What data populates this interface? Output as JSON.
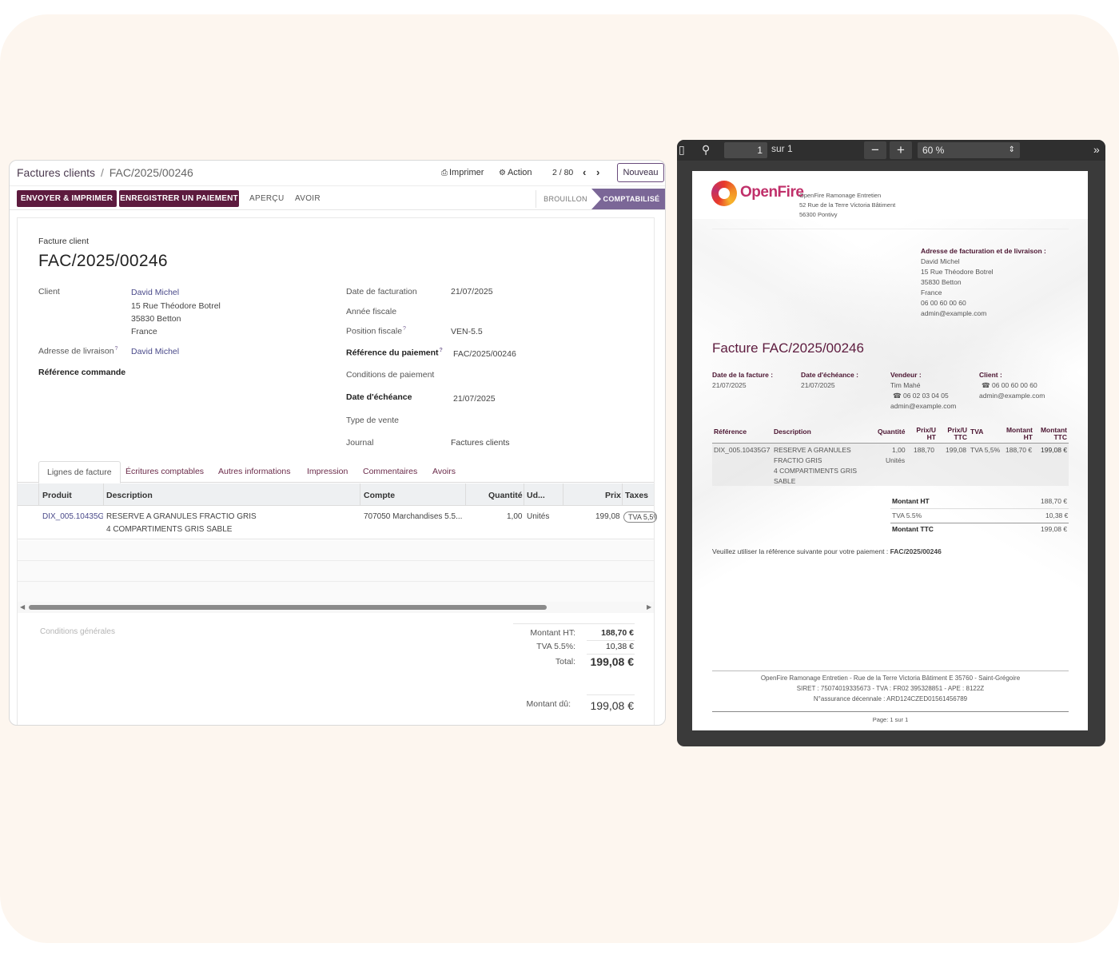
{
  "odoo": {
    "breadcrumb": {
      "parent": "Factures clients",
      "separator": "/",
      "current": "FAC/2025/00246"
    },
    "toolbar": {
      "print": "Imprimer",
      "action": "Action",
      "pager": "2 / 80",
      "new": "Nouveau"
    },
    "statusbar": {
      "send_print": "ENVOYER & IMPRIMER",
      "register_payment": "ENREGISTRER UN PAIEMENT",
      "preview": "APERÇU",
      "credit_note": "AVOIR",
      "stage_draft": "BROUILLON",
      "stage_posted": "COMPTABILISÉ"
    },
    "form": {
      "type_label": "Facture client",
      "number": "FAC/2025/00246",
      "client_label": "Client",
      "client_name": "David Michel",
      "client_street": "15 Rue Théodore Botrel",
      "client_city": "35830 Betton",
      "client_country": "France",
      "delivery_label": "Adresse de livraison",
      "delivery_value": "David Michel",
      "order_ref_label": "Référence commande",
      "invoice_date_label": "Date de facturation",
      "invoice_date": "21/07/2025",
      "fiscal_year_label": "Année fiscale",
      "fiscal_position_label": "Position fiscale",
      "fiscal_position": "VEN-5.5",
      "payment_ref_label": "Référence du paiement",
      "payment_ref": "FAC/2025/00246",
      "payment_terms_label": "Conditions de paiement",
      "due_date_label": "Date d'échéance",
      "due_date": "21/07/2025",
      "sale_type_label": "Type de vente",
      "journal_label": "Journal",
      "journal": "Factures clients",
      "help_mark": "?"
    },
    "tabs": [
      "Lignes de facture",
      "Écritures comptables",
      "Autres informations",
      "Impression",
      "Commentaires",
      "Avoirs"
    ],
    "lines": {
      "headers": {
        "product": "Produit",
        "description": "Description",
        "account": "Compte",
        "qty": "Quantité",
        "uom": "Ud...",
        "price": "Prix",
        "taxes": "Taxes"
      },
      "rows": [
        {
          "product": "DIX_005.10435G7",
          "desc1": "RESERVE A GRANULES FRACTIO GRIS",
          "desc2": "4 COMPARTIMENTS GRIS SABLE",
          "account": "707050 Marchandises 5.5...",
          "qty": "1,00",
          "uom": "Unités",
          "price": "199,08",
          "tax": "TVA 5,5%"
        }
      ]
    },
    "terms_placeholder": "Conditions générales",
    "totals": {
      "ht_label": "Montant HT:",
      "ht": "188,70 €",
      "tva_label": "TVA 5.5%:",
      "tva": "10,38 €",
      "total_label": "Total:",
      "total": "199,08 €",
      "due_label": "Montant dû:",
      "due": "199,08 €"
    }
  },
  "pdf": {
    "toolbar": {
      "page": "1",
      "of": "sur 1",
      "zoom_out": "−",
      "zoom_in": "+",
      "zoom": "60 %"
    },
    "company": {
      "logo_text": "OpenFire",
      "name": "OpenFire Ramonage Entretien",
      "street": "52 Rue de la Terre Victoria Bâtiment",
      "city": "56300 Pontivy"
    },
    "address": {
      "label": "Adresse de facturation et de livraison :",
      "name": "David Michel",
      "street": "15 Rue Théodore Botrel",
      "city": "35830 Betton",
      "country": "France",
      "phone": "06 00 60 00 60",
      "email": "admin@example.com"
    },
    "title": "Facture FAC/2025/00246",
    "info": {
      "invoice_date_label": "Date de la facture :",
      "invoice_date": "21/07/2025",
      "due_date_label": "Date d'échéance :",
      "due_date": "21/07/2025",
      "seller_label": "Vendeur :",
      "seller_name": "Tim Mahé",
      "seller_phone": "06 02 03 04 05",
      "seller_email": "admin@example.com",
      "client_label": "Client :",
      "client_phone": "06 00 60 00 60",
      "client_email": "admin@example.com"
    },
    "table": {
      "h_ref": "Référence",
      "h_desc": "Description",
      "h_qty": "Quantité",
      "h_pu_ht_1": "Prix/U",
      "h_pu_ht_2": "HT",
      "h_pu_ttc_1": "Prix/U",
      "h_pu_ttc_2": "TTC",
      "h_tva": "TVA",
      "h_mht_1": "Montant",
      "h_mht_2": "HT",
      "h_mttc_1": "Montant",
      "h_mttc_2": "TTC",
      "ref": "DIX_005.10435G7",
      "desc": [
        "RESERVE A GRANULES",
        "FRACTIO GRIS",
        "4 COMPARTIMENTS GRIS",
        "SABLE"
      ],
      "qty": "1,00",
      "unit": "Unités",
      "pu_ht": "188,70",
      "pu_ttc": "199,08",
      "tva": "TVA 5,5%",
      "m_ht": "188,70 €",
      "m_ttc": "199,08 €"
    },
    "totals": {
      "ht_label": "Montant HT",
      "ht": "188,70 €",
      "tva_label": "TVA 5.5%",
      "tva": "10,38 €",
      "ttc_label": "Montant TTC",
      "ttc": "199,08 €"
    },
    "payment_note": "Veuillez utiliser la référence suivante pour votre paiement :",
    "payment_ref": "FAC/2025/00246",
    "footer": {
      "line1": "OpenFire Ramonage Entretien - Rue de la Terre Victoria Bâtiment E 35760 - Saint-Grégoire",
      "line2": "SIRET : 75074019335673 - TVA : FR02 395328851 - APE : 8122Z",
      "line3": "N°assurance décennale : ARD124CZED01561456789",
      "page": "Page: 1 sur 1"
    }
  }
}
